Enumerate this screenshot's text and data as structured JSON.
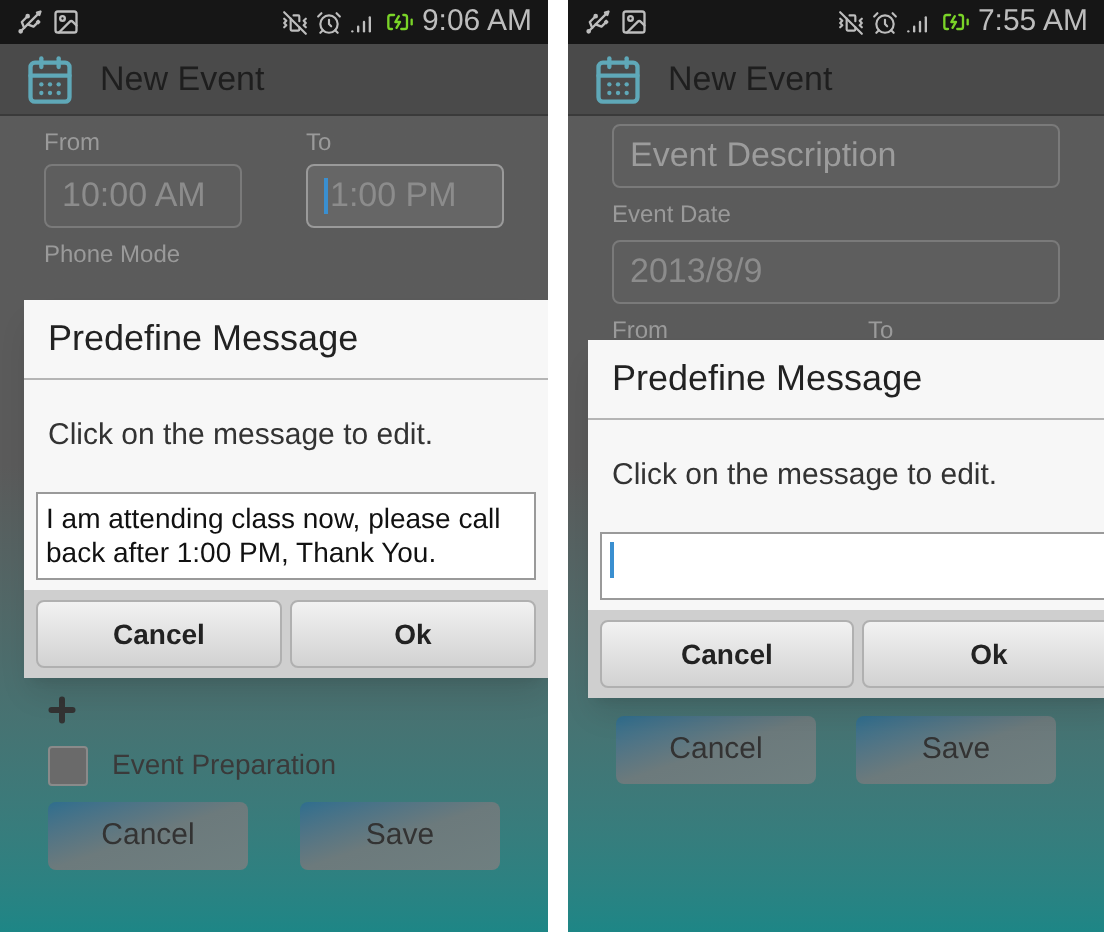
{
  "screens": [
    {
      "status_bar": {
        "time": "9:06 AM"
      },
      "title": "New Event",
      "form_top": [
        {
          "kind": "time_pair",
          "fields": [
            {
              "label": "From",
              "value": "10:00 AM",
              "focused": false
            },
            {
              "label": "To",
              "value": "1:00 PM",
              "focused": true
            }
          ]
        },
        {
          "kind": "label",
          "text": "Phone Mode"
        }
      ],
      "dialog": {
        "title": "Predefine Message",
        "message": "Click on the message to edit.",
        "input": {
          "value": "I am attending class now, please call back after 1:00 PM, Thank You.",
          "focused": false
        },
        "buttons": [
          "Cancel",
          "Ok"
        ]
      },
      "form_bottom": [
        {
          "kind": "add"
        },
        {
          "kind": "checkbox",
          "label": "Event Preparation",
          "checked": false
        },
        {
          "kind": "actions",
          "buttons": [
            "Cancel",
            "Save"
          ]
        }
      ]
    },
    {
      "status_bar": {
        "time": "7:55 AM"
      },
      "title": "New Event",
      "form_top": [
        {
          "kind": "field",
          "placeholder": "Event Description"
        },
        {
          "kind": "label",
          "text": "Event Date"
        },
        {
          "kind": "field",
          "value": "2013/8/9"
        },
        {
          "kind": "label_pair",
          "labels": [
            "From",
            "To"
          ]
        }
      ],
      "dialog": {
        "title": "Predefine Message",
        "message": "Click on the message to edit.",
        "input": {
          "focused": true
        },
        "buttons": [
          "Cancel",
          "Ok"
        ]
      },
      "form_bottom": [
        {
          "kind": "actions",
          "buttons": [
            "Cancel",
            "Save"
          ]
        }
      ]
    }
  ]
}
